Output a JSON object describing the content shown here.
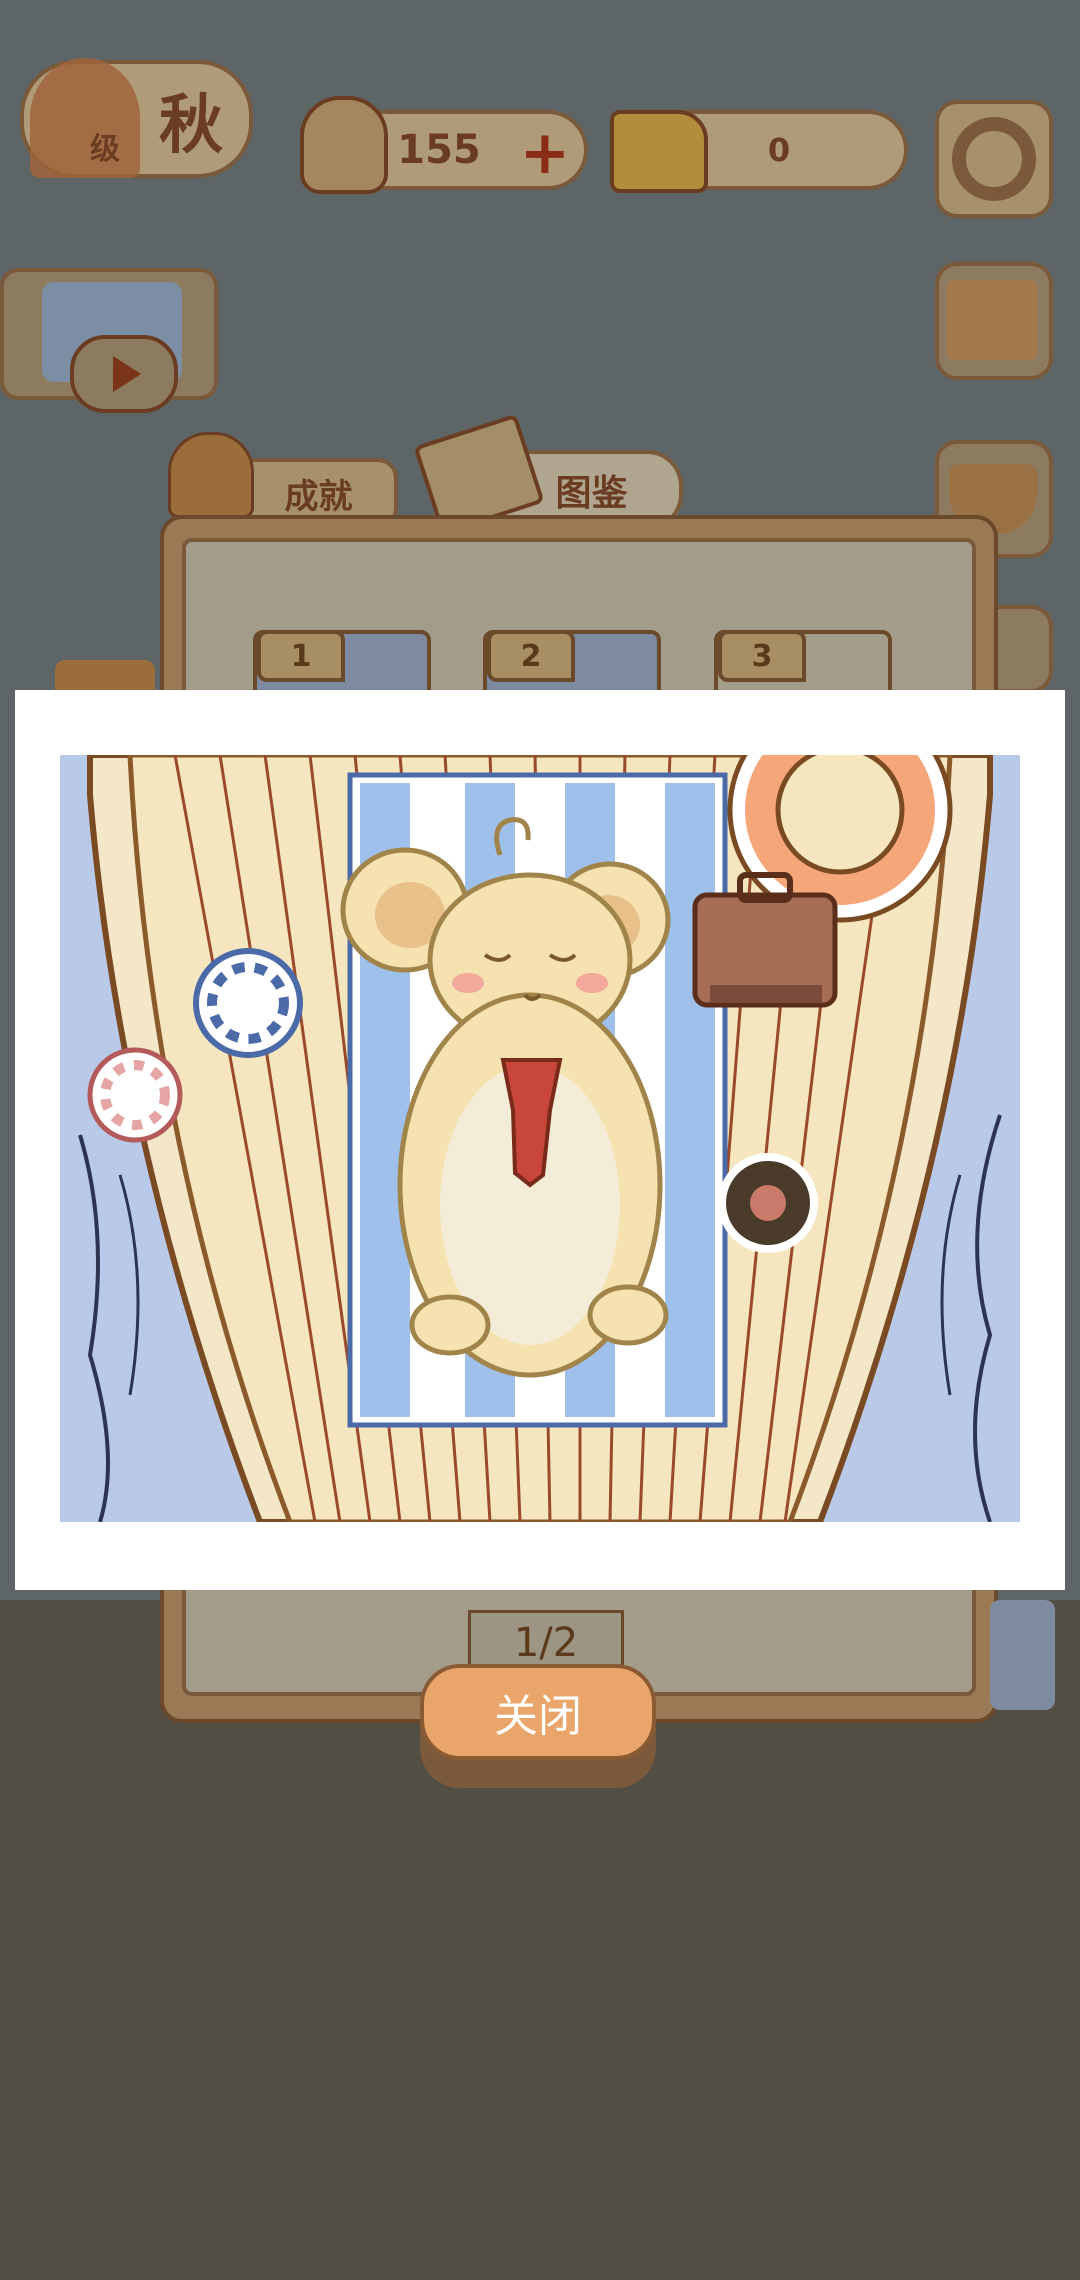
{
  "hud": {
    "season_text": "秋",
    "level_glyph": "级",
    "fish_count": "155",
    "fish_plus": "+",
    "cheese_count": "0"
  },
  "icons": {
    "tree": "tree-icon",
    "fish": "fishbone-icon",
    "cheese": "cheese-icon",
    "settings": "gear-icon",
    "shop": "market-stall-icon",
    "basket": "basket-icon",
    "video": "video-reward-icon",
    "achievements": "trophy-icon",
    "guide": "book-icon"
  },
  "tabs": {
    "achievements_label": "成就",
    "guide_label": "图鉴"
  },
  "collection": {
    "slots": [
      "1",
      "2",
      "3"
    ],
    "page_indicator": "1/2"
  },
  "modal": {
    "close_label": "关闭"
  },
  "colors": {
    "accent_orange": "#e9a56a",
    "deck_cream": "#f6e6bf",
    "towel_blue": "#9fc0ea",
    "tie_red": "#c9463c"
  }
}
